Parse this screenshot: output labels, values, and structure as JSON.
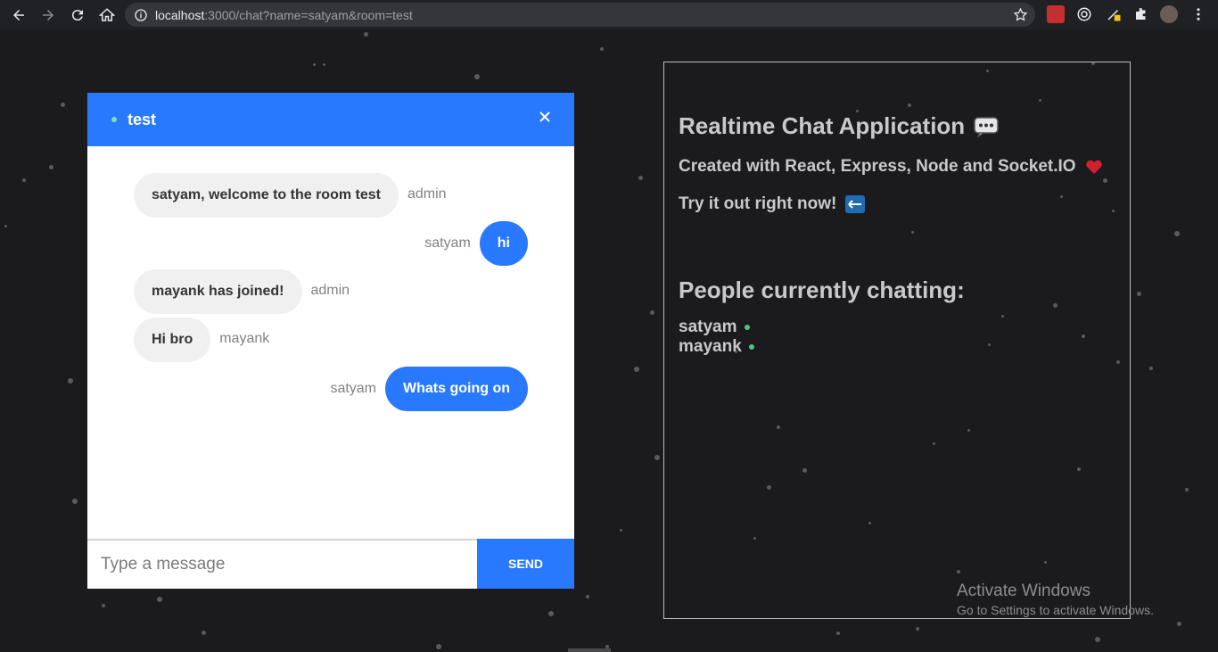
{
  "browser": {
    "url_host": "localhost",
    "url_rest": ":3000/chat?name=satyam&room=test"
  },
  "chat": {
    "room": "test",
    "messages": [
      {
        "text": "satyam, welcome to the room test",
        "sender": "admin",
        "mine": false
      },
      {
        "text": "hi",
        "sender": "satyam",
        "mine": true
      },
      {
        "text": "mayank has joined!",
        "sender": "admin",
        "mine": false
      },
      {
        "text": "Hi bro",
        "sender": "mayank",
        "mine": false
      },
      {
        "text": "Whats going on",
        "sender": "satyam",
        "mine": true
      }
    ],
    "input_placeholder": "Type a message",
    "send_label": "Send"
  },
  "info": {
    "title": "Realtime Chat Application",
    "subtitle": "Created with React, Express, Node and Socket.IO",
    "cta": "Try it out right now!",
    "people_title": "People currently chatting:",
    "people": [
      "satyam",
      "mayank"
    ]
  },
  "watermark": {
    "line1": "Activate Windows",
    "line2": "Go to Settings to activate Windows."
  },
  "colors": {
    "accent": "#2979ff",
    "online": "#4ec57d",
    "background": "#1b1b1d"
  }
}
